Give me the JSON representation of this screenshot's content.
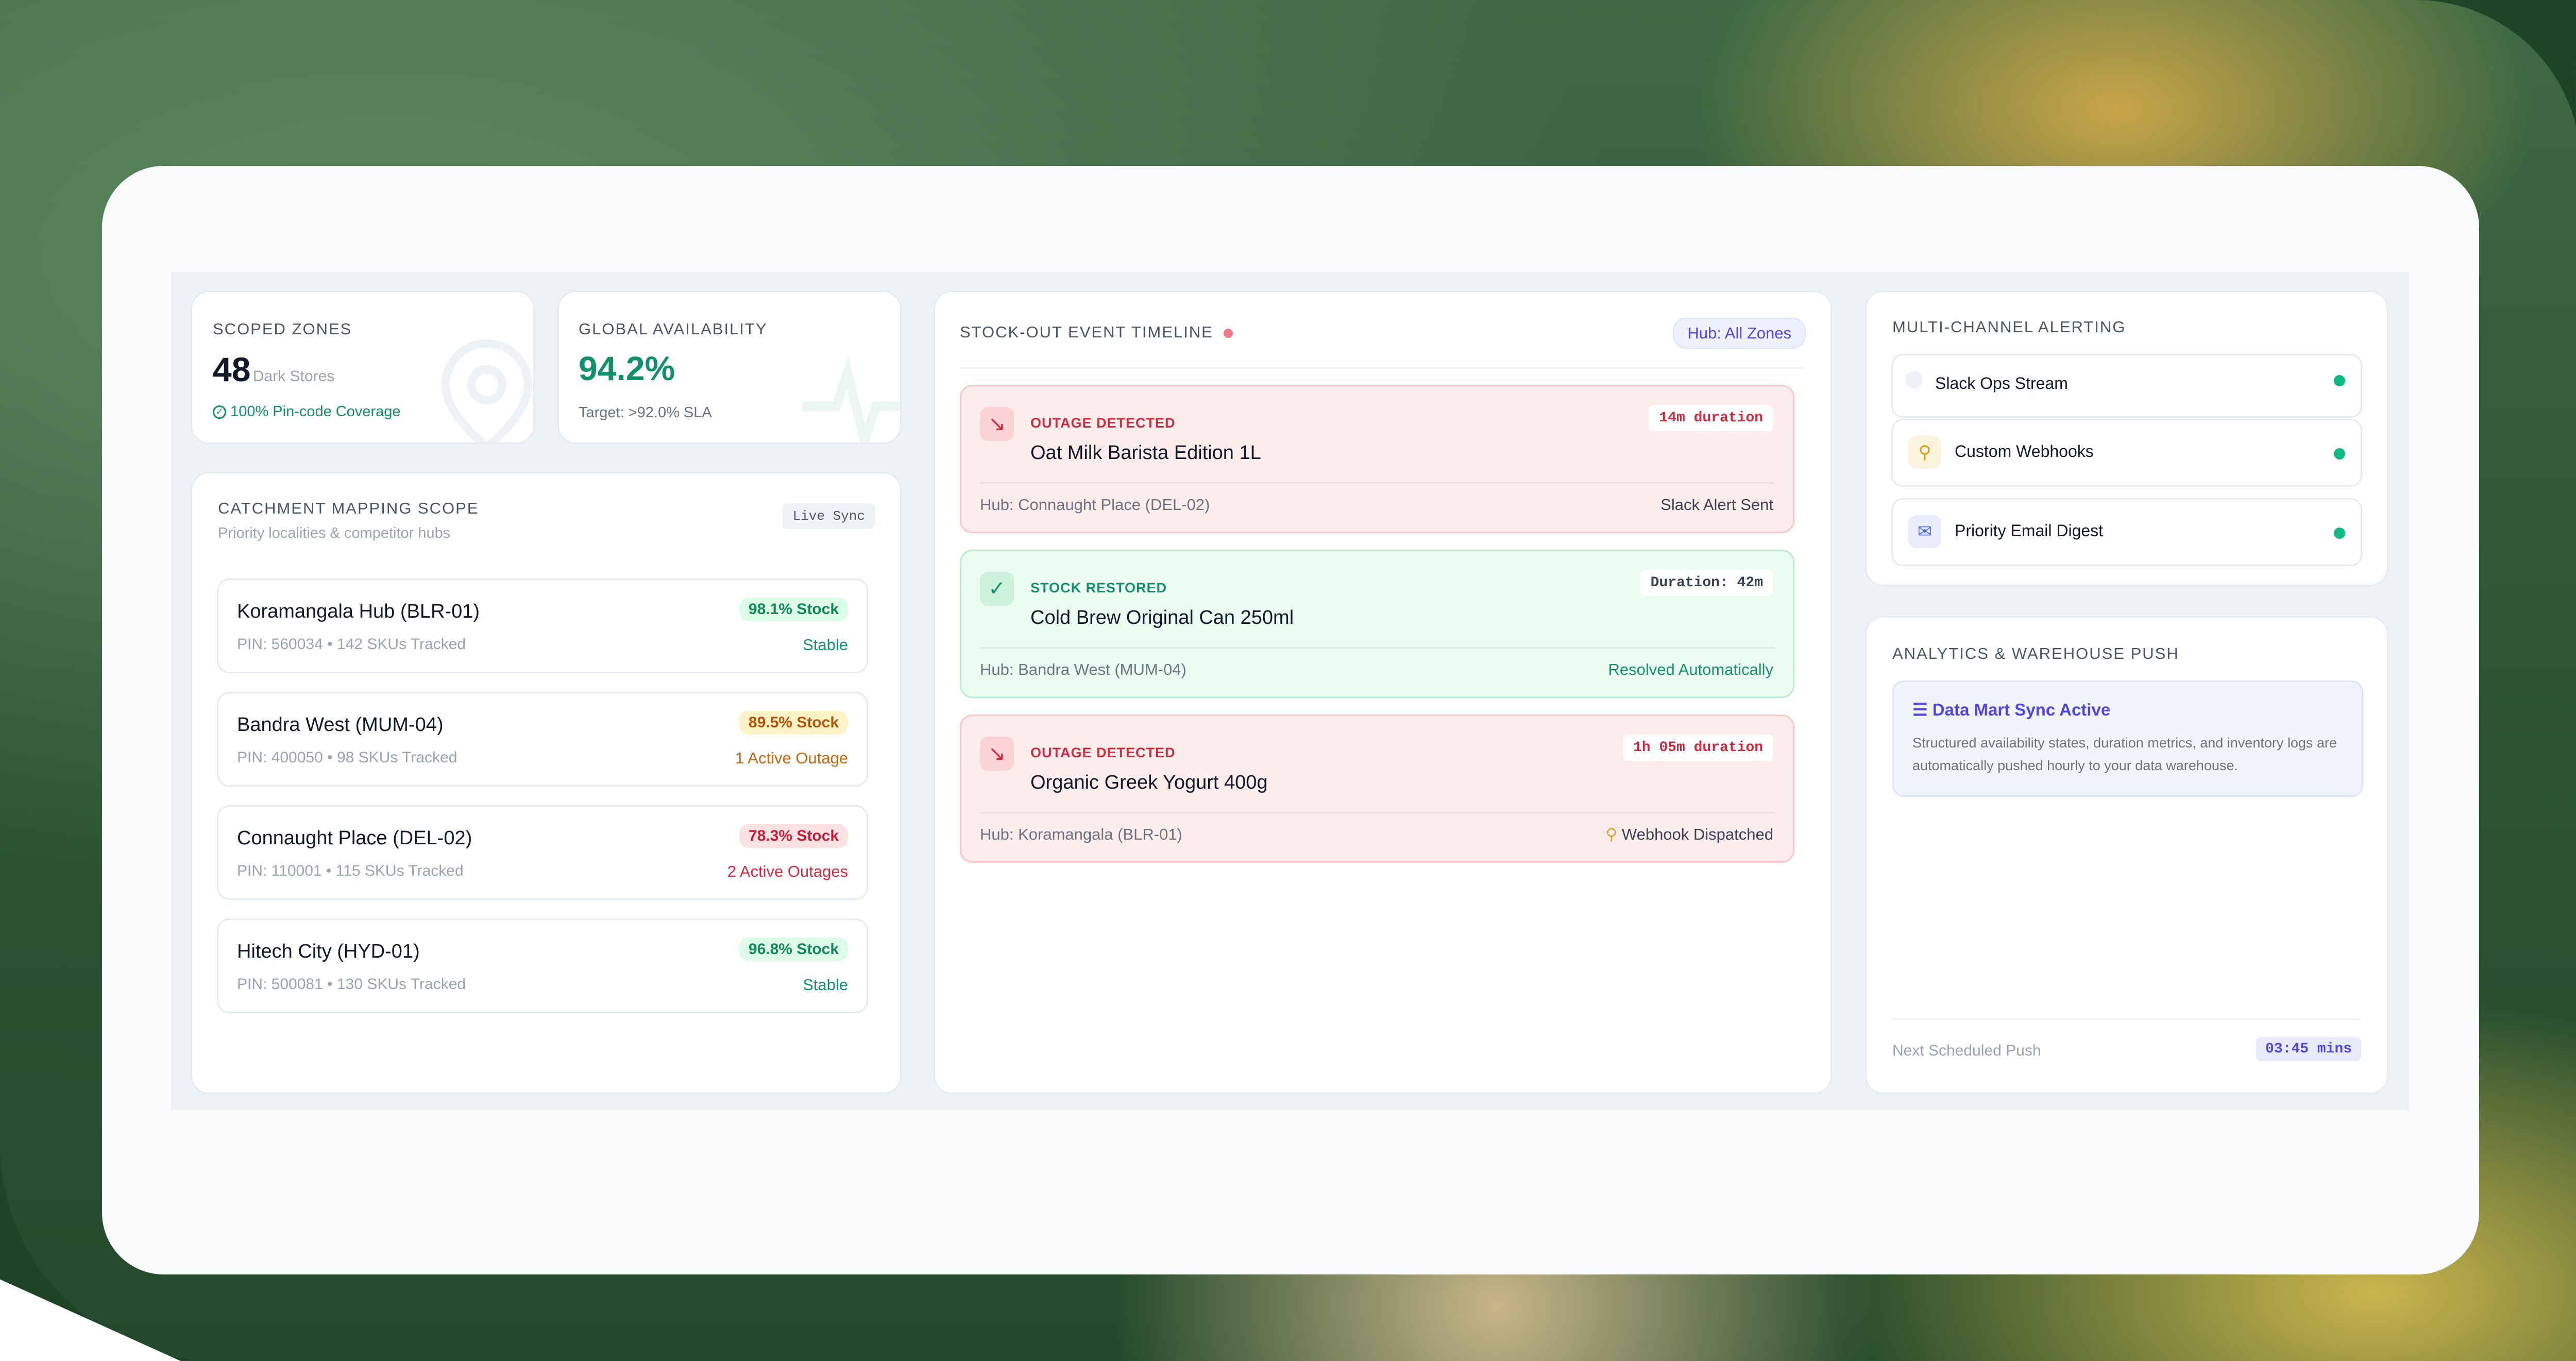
{
  "zones": {
    "label": "SCOPED ZONES",
    "count": "48",
    "count_unit": "Dark Stores",
    "coverage": "100% Pin-code Coverage"
  },
  "availability": {
    "label": "GLOBAL AVAILABILITY",
    "value": "94.2%",
    "target": "Target: >92.0% SLA"
  },
  "catchment": {
    "title": "CATCHMENT MAPPING SCOPE",
    "subtitle": "Priority localities & competitor hubs",
    "badge": "Live Sync",
    "hubs": [
      {
        "name": "Koramangala Hub (BLR-01)",
        "sub": "PIN: 560034 • 142 SKUs Tracked",
        "stock": "98.1% Stock",
        "status": "Stable",
        "tone": "green"
      },
      {
        "name": "Bandra West (MUM-04)",
        "sub": "PIN: 400050 • 98 SKUs Tracked",
        "stock": "89.5% Stock",
        "status": "1 Active Outage",
        "tone": "amber"
      },
      {
        "name": "Connaught Place (DEL-02)",
        "sub": "PIN: 110001 • 115 SKUs Tracked",
        "stock": "78.3% Stock",
        "status": "2 Active Outages",
        "tone": "red"
      },
      {
        "name": "Hitech City (HYD-01)",
        "sub": "PIN: 500081 • 130 SKUs Tracked",
        "stock": "96.8% Stock",
        "status": "Stable",
        "tone": "green"
      }
    ]
  },
  "timeline": {
    "title": "STOCK-OUT EVENT TIMELINE",
    "filter": "Hub: All Zones",
    "events": [
      {
        "tag": "OUTAGE DETECTED",
        "title": "Oat Milk Barista Edition 1L",
        "duration": "14m duration",
        "hub": "Hub: Connaught Place (DEL-02)",
        "status": "Slack Alert Sent",
        "kind": "outage",
        "icon": "trend-down-icon"
      },
      {
        "tag": "STOCK RESTORED",
        "title": "Cold Brew Original Can 250ml",
        "duration": "Duration: 42m",
        "hub": "Hub: Bandra West (MUM-04)",
        "status": "Resolved Automatically",
        "kind": "restored",
        "icon": "check-circle-icon"
      },
      {
        "tag": "OUTAGE DETECTED",
        "title": "Organic Greek Yogurt 400g",
        "duration": "1h 05m duration",
        "hub": "Hub: Koramangala (BLR-01)",
        "status": "Webhook Dispatched",
        "kind": "outage",
        "icon": "trend-down-icon"
      }
    ]
  },
  "alerting": {
    "title": "MULTI-CHANNEL ALERTING",
    "channels": [
      {
        "label": "Slack Ops Stream",
        "icon": "slack-icon"
      },
      {
        "label": "Custom Webhooks",
        "icon": "webhook-icon"
      },
      {
        "label": "Priority Email Digest",
        "icon": "mail-icon"
      }
    ]
  },
  "analytics": {
    "title": "ANALYTICS & WAREHOUSE PUSH",
    "sync_title": "Data Mart Sync Active",
    "sync_desc": "Structured availability states, duration metrics, and inventory logs are automatically pushed hourly to your data warehouse.",
    "next_label": "Next Scheduled Push",
    "next_value": "03:45 mins"
  },
  "colors": {
    "green": "#12906a",
    "amber": "#c2660f",
    "red": "#d12a3f",
    "indigo": "#4f46e5"
  }
}
